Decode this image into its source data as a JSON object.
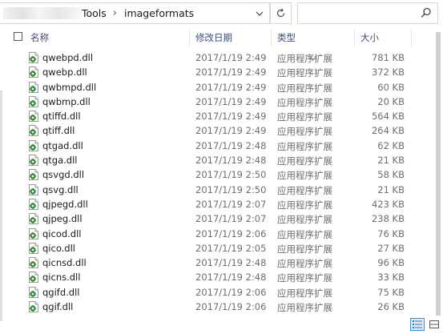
{
  "address": {
    "path": [
      "Tools",
      "imageformats"
    ],
    "separator": "›"
  },
  "search": {
    "placeholder": ""
  },
  "columns": {
    "name": "名称",
    "date": "修改日期",
    "type": "类型",
    "size": "大小"
  },
  "files": [
    {
      "name": "qwebpd.dll",
      "date": "2017/1/19 2:49",
      "type": "应用程序扩展",
      "size": "781 KB"
    },
    {
      "name": "qwebp.dll",
      "date": "2017/1/19 2:49",
      "type": "应用程序扩展",
      "size": "372 KB"
    },
    {
      "name": "qwbmpd.dll",
      "date": "2017/1/19 2:49",
      "type": "应用程序扩展",
      "size": "60 KB"
    },
    {
      "name": "qwbmp.dll",
      "date": "2017/1/19 2:49",
      "type": "应用程序扩展",
      "size": "20 KB"
    },
    {
      "name": "qtiffd.dll",
      "date": "2017/1/19 2:49",
      "type": "应用程序扩展",
      "size": "564 KB"
    },
    {
      "name": "qtiff.dll",
      "date": "2017/1/19 2:49",
      "type": "应用程序扩展",
      "size": "264 KB"
    },
    {
      "name": "qtgad.dll",
      "date": "2017/1/19 2:48",
      "type": "应用程序扩展",
      "size": "62 KB"
    },
    {
      "name": "qtga.dll",
      "date": "2017/1/19 2:48",
      "type": "应用程序扩展",
      "size": "21 KB"
    },
    {
      "name": "qsvgd.dll",
      "date": "2017/1/19 2:50",
      "type": "应用程序扩展",
      "size": "58 KB"
    },
    {
      "name": "qsvg.dll",
      "date": "2017/1/19 2:50",
      "type": "应用程序扩展",
      "size": "21 KB"
    },
    {
      "name": "qjpegd.dll",
      "date": "2017/1/19 2:07",
      "type": "应用程序扩展",
      "size": "423 KB"
    },
    {
      "name": "qjpeg.dll",
      "date": "2017/1/19 2:07",
      "type": "应用程序扩展",
      "size": "238 KB"
    },
    {
      "name": "qicod.dll",
      "date": "2017/1/19 2:06",
      "type": "应用程序扩展",
      "size": "76 KB"
    },
    {
      "name": "qico.dll",
      "date": "2017/1/19 2:05",
      "type": "应用程序扩展",
      "size": "27 KB"
    },
    {
      "name": "qicnsd.dll",
      "date": "2017/1/19 2:48",
      "type": "应用程序扩展",
      "size": "96 KB"
    },
    {
      "name": "qicns.dll",
      "date": "2017/1/19 2:48",
      "type": "应用程序扩展",
      "size": "33 KB"
    },
    {
      "name": "qgifd.dll",
      "date": "2017/1/19 2:06",
      "type": "应用程序扩展",
      "size": "75 KB"
    },
    {
      "name": "qgif.dll",
      "date": "2017/1/19 2:06",
      "type": "应用程序扩展",
      "size": "26 KB"
    }
  ],
  "icons": {
    "file": "dll-file-icon",
    "refresh": "refresh-icon",
    "search": "search-icon",
    "dropdown": "chevron-down-icon"
  },
  "colors": {
    "header_text": "#3a4f7a",
    "meta_text": "#6d6d6d",
    "border": "#d9d9d9"
  }
}
